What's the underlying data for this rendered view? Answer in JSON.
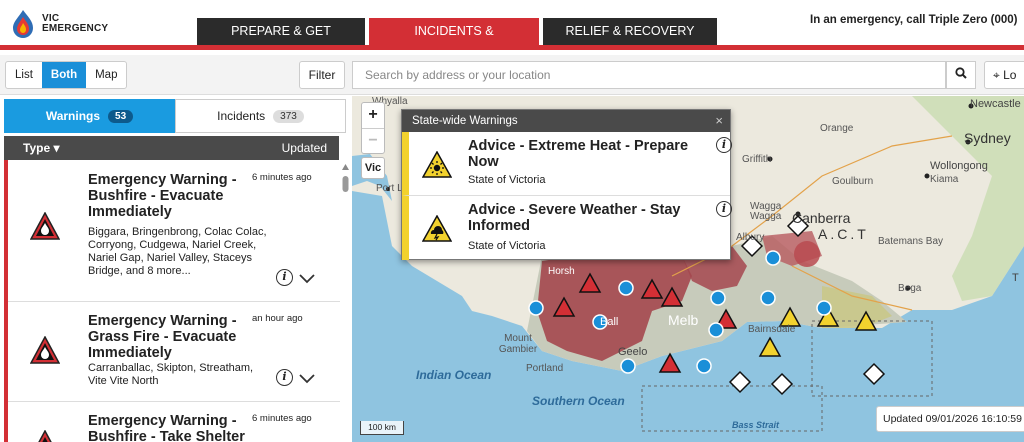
{
  "header": {
    "logo_line1": "VIC",
    "logo_line2": "EMERGENCY",
    "nav": [
      "PREPARE & GET READY",
      "INCIDENTS & WARNINGS",
      "RELIEF & RECOVERY"
    ],
    "call_text": "In an emergency, call Triple Zero (000)",
    "accent_color": "#d32f35"
  },
  "toolbar": {
    "views": [
      "List",
      "Both",
      "Map"
    ],
    "active_view": "Both",
    "filter_label": "Filter",
    "search_placeholder": "Search by address or your location",
    "locate_label": "Lo"
  },
  "panel": {
    "warnings_tab": "Warnings",
    "warnings_count": "53",
    "incidents_tab": "Incidents",
    "incidents_count": "373",
    "col_type": "Type",
    "col_updated": "Updated",
    "items": [
      {
        "title": "Emergency Warning - Bushfire - Evacuate Immediately",
        "time": "6 minutes ago",
        "desc": "Biggara, Bringenbrong, Colac Colac, Corryong, Cudgewa, Nariel Creek, Nariel Gap, Nariel Valley, Staceys Bridge, and 8 more..."
      },
      {
        "title": "Emergency Warning - Grass Fire - Evacuate Immediately",
        "time": "an hour ago",
        "desc": "Carranballac, Skipton, Streatham, Vite Vite North"
      },
      {
        "title": "Emergency Warning - Bushfire - Take Shelter",
        "time": "6 minutes ago",
        "desc": ""
      }
    ]
  },
  "popup": {
    "title": "State-wide Warnings",
    "close": "×",
    "warnings": [
      {
        "title": "Advice - Extreme Heat - Prepare Now",
        "sub": "State of Victoria",
        "icon": "extreme-heat-icon"
      },
      {
        "title": "Advice - Severe Weather - Stay Informed",
        "sub": "State of Victoria",
        "icon": "severe-weather-icon"
      }
    ]
  },
  "map": {
    "zoom_in": "+",
    "zoom_out": "−",
    "vic_button": "Vic",
    "scale": "100 km",
    "updated": "Updated 09/01/2026 16:10:59",
    "labels": {
      "newcastle": "Newcastle",
      "sydney": "Sydney",
      "wollongong": "Wollongong",
      "kiama": "Kiama",
      "orange": "Orange",
      "griffith": "Griffith",
      "goulburn": "Goulburn",
      "wagga": "Wagga Wagga",
      "canberra": "Canberra",
      "act": "A.C.T",
      "batemans": "Batemans Bay",
      "albury": "Albury",
      "bega": "Bega",
      "whyalla": "Whyalla",
      "portlincoln": "Port Lincoln",
      "mountgambier": "Mount Gambier",
      "portland": "Portland",
      "ballarat": "Ball",
      "geelong": "Geelo",
      "melbourne": "Melb",
      "horsham": "Horsh",
      "bairnsdale": "Bairnsdale",
      "indian": "Indian Ocean",
      "southern": "Southern  Ocean",
      "bassstrait": "Bass Strait",
      "edge": "T"
    }
  }
}
